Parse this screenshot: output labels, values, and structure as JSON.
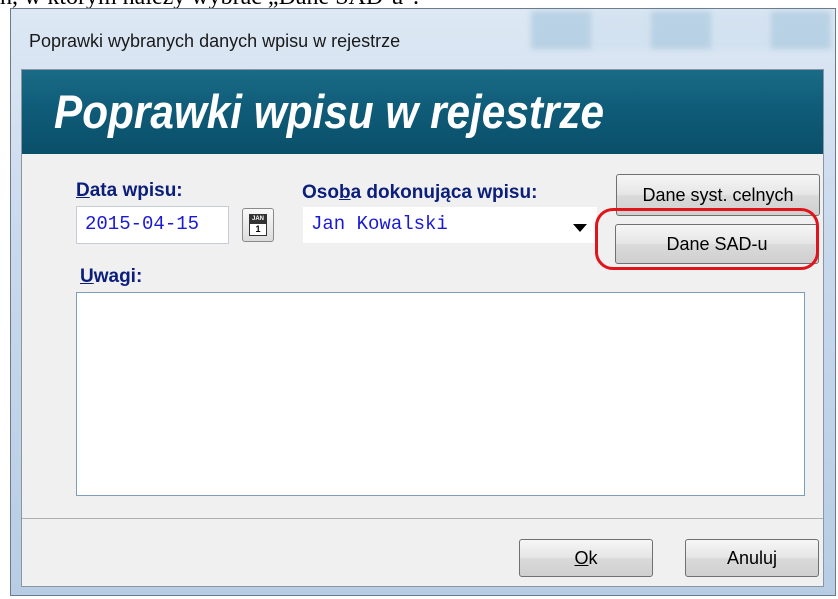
{
  "document": {
    "partial_text": "h, w którym należy wybrać „Dane SAD-u\"."
  },
  "window": {
    "title": "Poprawki wybranych danych wpisu w rejestrze"
  },
  "banner": {
    "title": "Poprawki wpisu w rejestrze"
  },
  "form": {
    "date_label_accel": "D",
    "date_label_rest": "ata wpisu:",
    "date_value": "2015-04-15",
    "calendar_icon_text": "JAN",
    "calendar_icon_day": "1",
    "person_label_pre": "Oso",
    "person_label_accel": "b",
    "person_label_post": "a dokonująca wpisu:",
    "person_value": "Jan Kowalski",
    "notes_label_accel": "U",
    "notes_label_rest": "wagi:",
    "notes_value": ""
  },
  "buttons": {
    "customs_systems": "Dane syst. celnych",
    "sad_data": "Dane SAD-u",
    "ok_accel": "O",
    "ok_rest": "k",
    "cancel": "Anuluj"
  },
  "colors": {
    "banner": "#0f5c79",
    "label": "#0a1e7a",
    "input_text": "#1a1ad6",
    "highlight": "#e0151b"
  }
}
